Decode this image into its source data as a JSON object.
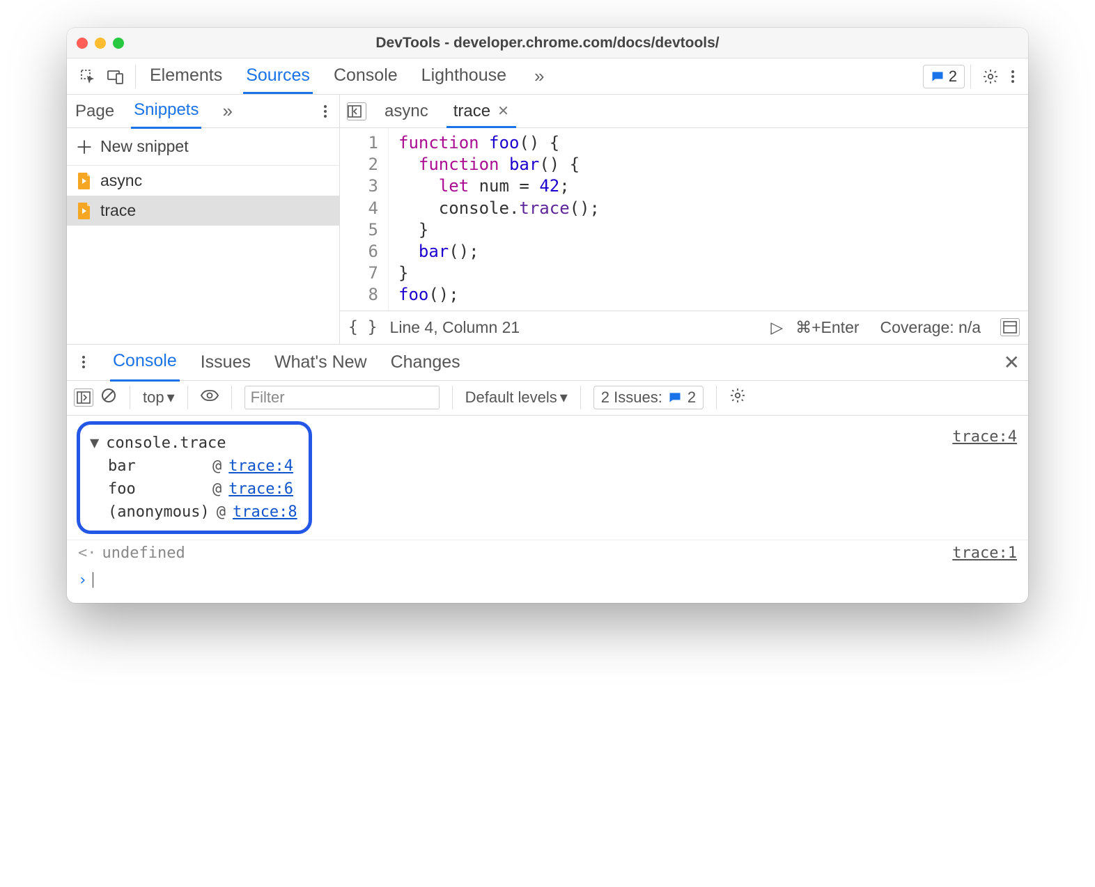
{
  "window": {
    "title": "DevTools - developer.chrome.com/docs/devtools/"
  },
  "toolbar": {
    "tabs": [
      "Elements",
      "Sources",
      "Console",
      "Lighthouse"
    ],
    "activeTab": "Sources",
    "issues_count": "2"
  },
  "left": {
    "tabs": [
      "Page",
      "Snippets"
    ],
    "activeTab": "Snippets",
    "new_snippet_label": "New snippet",
    "snippets": [
      {
        "name": "async",
        "selected": false
      },
      {
        "name": "trace",
        "selected": true
      }
    ]
  },
  "editor": {
    "tabs": [
      {
        "name": "async",
        "active": false,
        "closable": false
      },
      {
        "name": "trace",
        "active": true,
        "closable": true
      }
    ],
    "code_lines": [
      "function foo() {",
      "  function bar() {",
      "    let num = 42;",
      "    console.trace();",
      "  }",
      "  bar();",
      "}",
      "foo();"
    ],
    "status": {
      "position": "Line 4, Column 21",
      "run_hint": "⌘+Enter",
      "coverage": "Coverage: n/a"
    }
  },
  "drawer": {
    "tabs": [
      "Console",
      "Issues",
      "What's New",
      "Changes"
    ],
    "activeTab": "Console"
  },
  "console_toolbar": {
    "context": "top",
    "filter_placeholder": "Filter",
    "levels": "Default levels",
    "issues_label": "2 Issues:",
    "issues_count": "2"
  },
  "console": {
    "trace_header": "console.trace",
    "trace_source": "trace:4",
    "stack": [
      {
        "fn": "bar",
        "at": "@",
        "loc": "trace:4"
      },
      {
        "fn": "foo",
        "at": "@",
        "loc": "trace:6"
      },
      {
        "fn": "(anonymous)",
        "at": "@",
        "loc": "trace:8"
      }
    ],
    "undefined_label": "undefined",
    "undefined_source": "trace:1"
  }
}
